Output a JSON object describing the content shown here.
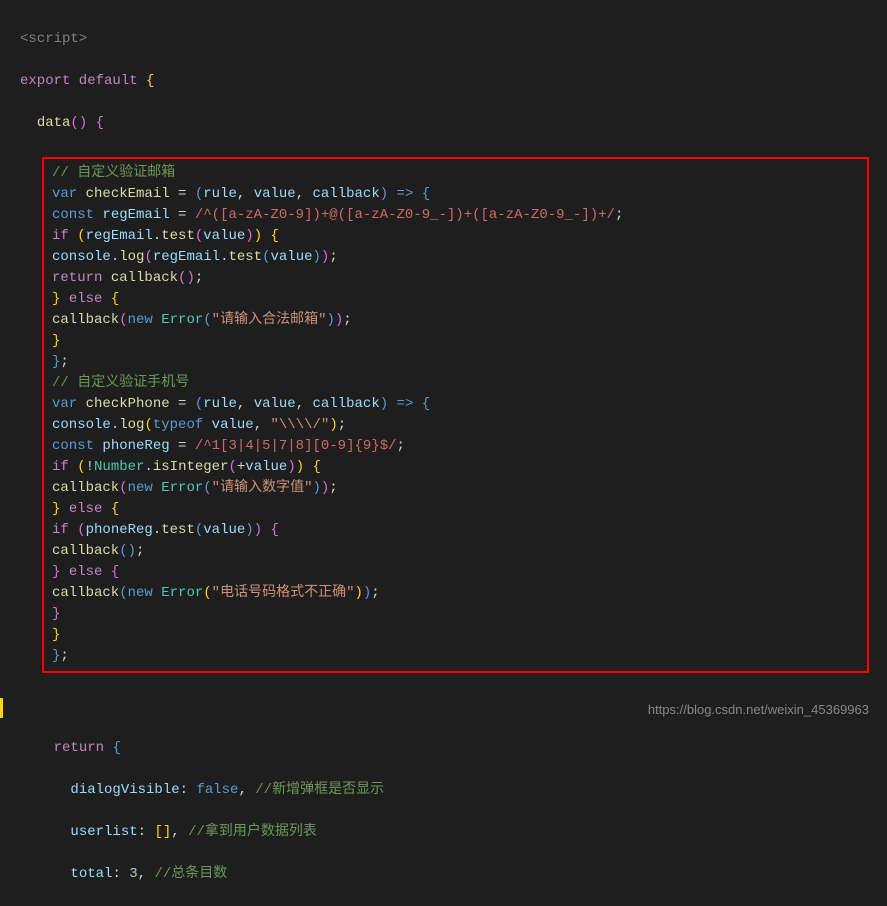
{
  "code": {
    "scriptOpen": "<script>",
    "exportDefault": "export default",
    "dataFunc": "data",
    "comment1": "// 自定义验证邮箱",
    "varKw": "var",
    "constKw": "const",
    "checkEmail": "checkEmail",
    "rule": "rule",
    "value": "value",
    "callback": "callback",
    "regEmail": "regEmail",
    "emailRegex": "/^([a-zA-Z0-9])+@([a-zA-Z0-9_-])+([a-zA-Z0-9_-])+/",
    "ifKw": "if",
    "elseKw": "else",
    "test": "test",
    "console": "console",
    "log": "log",
    "returnKw": "return",
    "newKw": "new",
    "Error": "Error",
    "emailErrStr": "\"请输入合法邮箱\"",
    "comment2": "// 自定义验证手机号",
    "checkPhone": "checkPhone",
    "typeofKw": "typeof",
    "slashStr": "\"\\\\\\\\/\"",
    "phoneReg": "phoneReg",
    "phoneRegex": "/^1[3|4|5|7|8][0-9]{9}$/",
    "Number": "Number",
    "isInteger": "isInteger",
    "numErrStr": "\"请输入数字值\"",
    "phoneErrStr": "\"电话号码格式不正确\"",
    "dialogVisible": "dialogVisible",
    "false": "false",
    "comment3": "//新增弹框是否显示",
    "userlist": "userlist",
    "comment4": "//拿到用户数据列表",
    "total": "total",
    "three": "3",
    "comment5": "//总条目数"
  },
  "watermark": "https://blog.csdn.net/weixin_45369963"
}
